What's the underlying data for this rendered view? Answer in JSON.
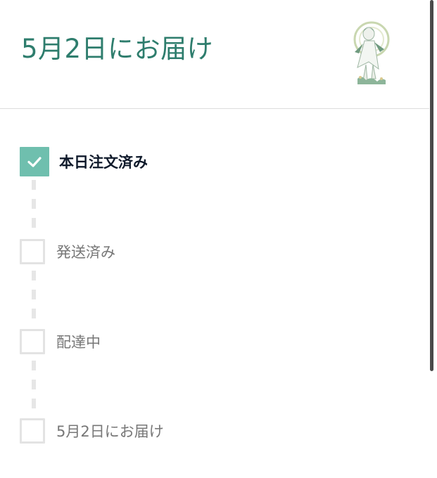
{
  "header": {
    "title": "5月2日にお届け",
    "product_image_icon": "product-figure-thumbnail"
  },
  "colors": {
    "accent": "#2e7d6d",
    "check_fill": "#6fbfae",
    "box_border": "#e3e3e3",
    "connector": "#e6e6e6"
  },
  "tracking": {
    "steps": [
      {
        "label": "本日注文済み",
        "completed": true
      },
      {
        "label": "発送済み",
        "completed": false
      },
      {
        "label": "配達中",
        "completed": false
      },
      {
        "label": "5月2日にお届け",
        "completed": false
      }
    ]
  }
}
